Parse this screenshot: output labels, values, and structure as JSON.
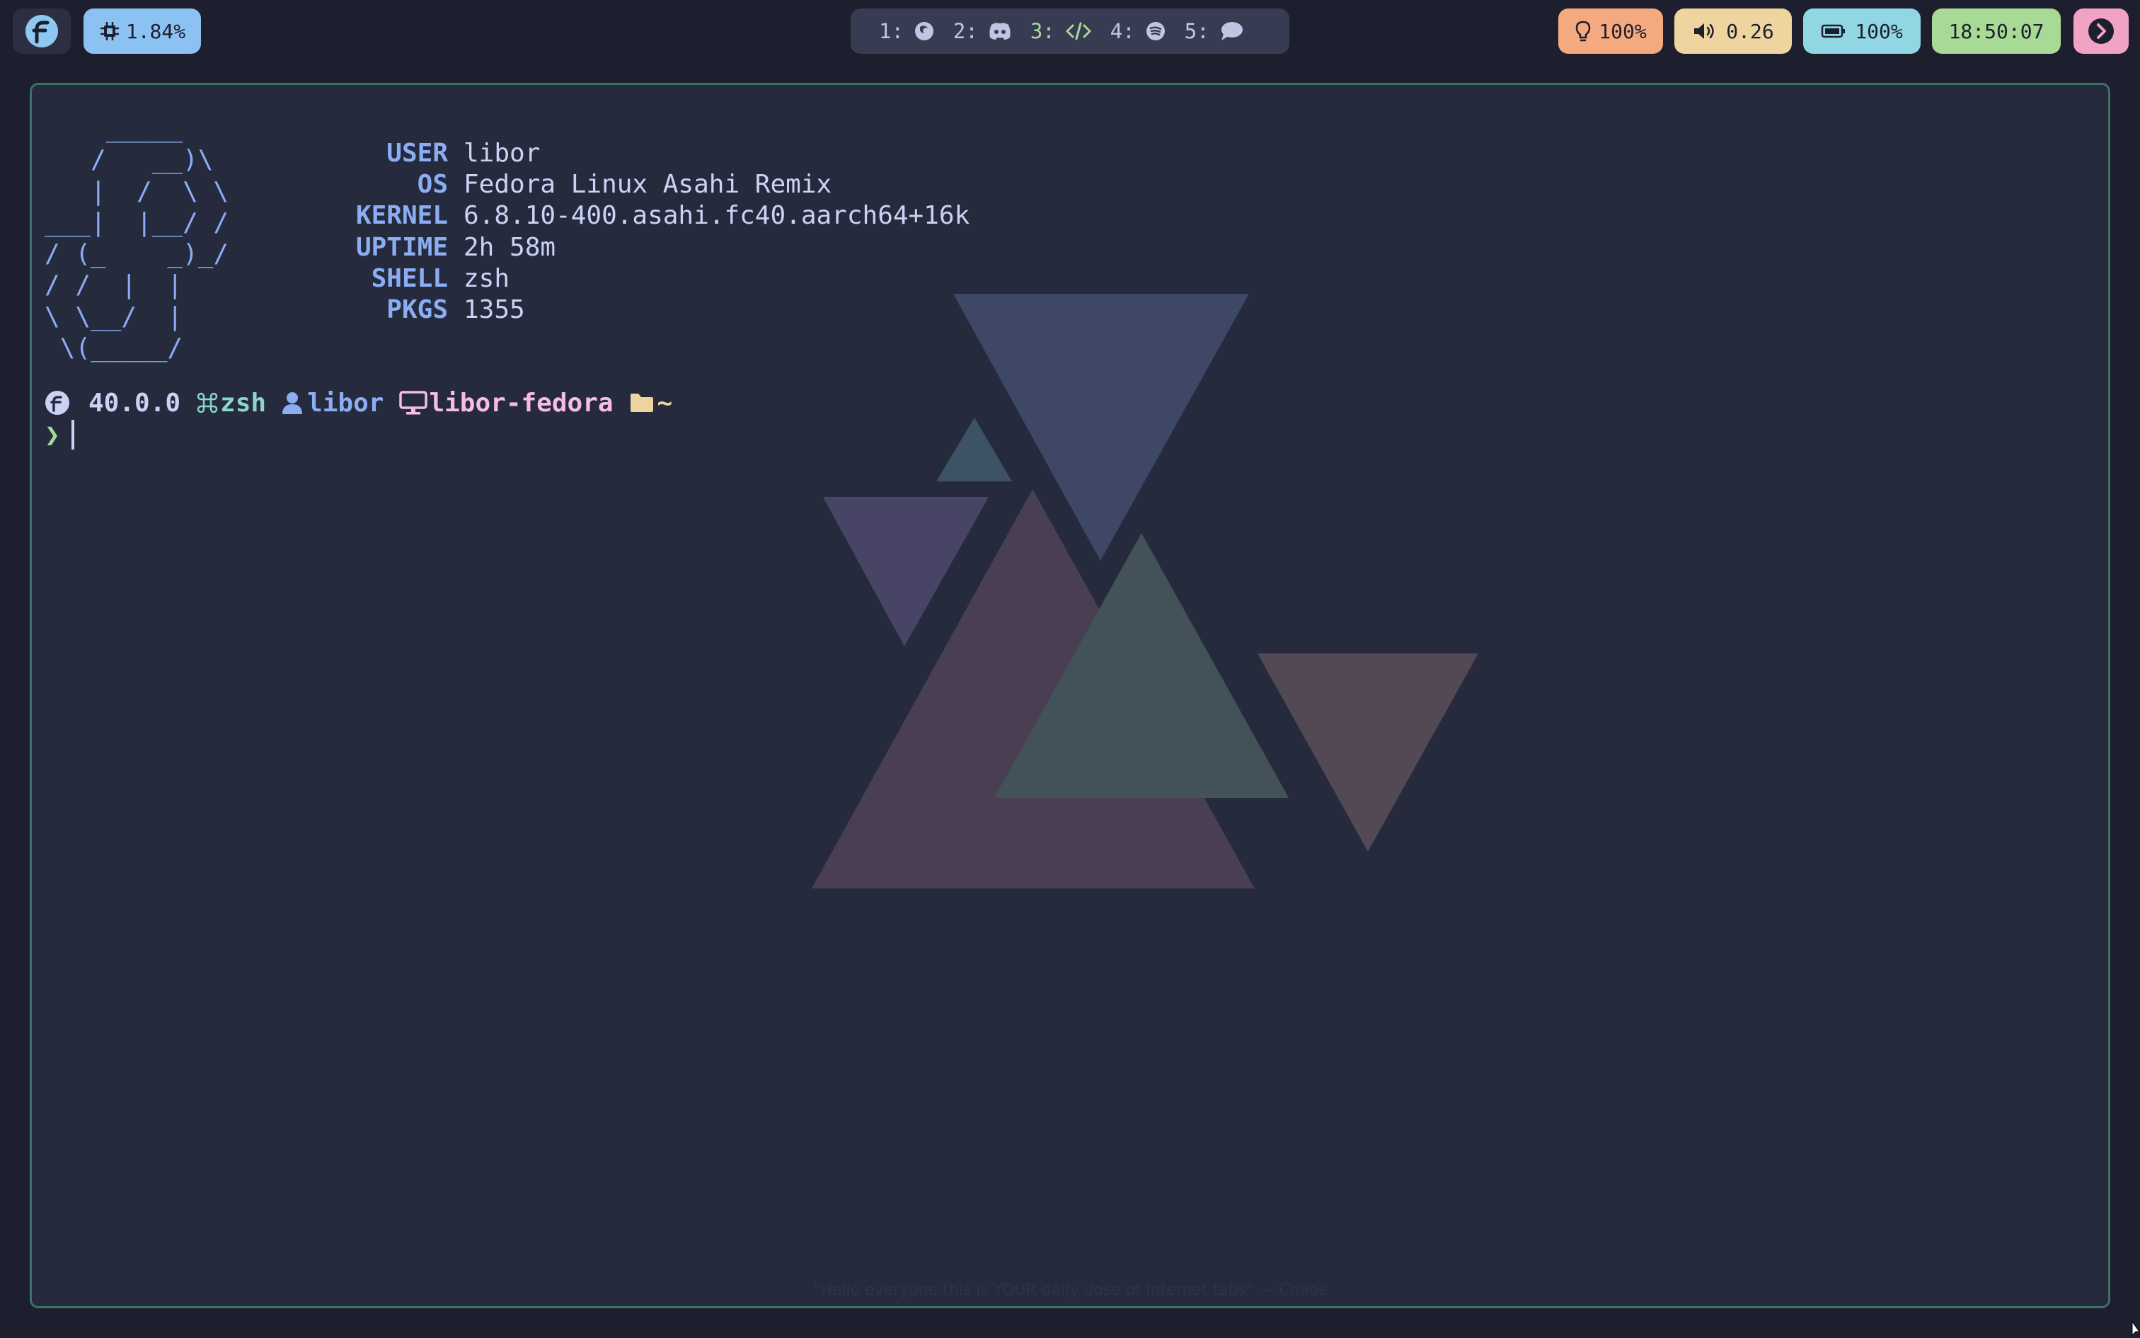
{
  "colors": {
    "background": "#1e1f2e",
    "terminal_bg": "#262a3d",
    "terminal_border": "#3f6f66",
    "blue": "#8aadf4",
    "green": "#a6da95",
    "teal": "#8bd5ca",
    "pink": "#f5bde6",
    "yellow": "#eed49f",
    "peach": "#f5a97f",
    "sky": "#91d7e3",
    "text": "#cad3f5"
  },
  "topbar": {
    "launcher": {
      "icon": "fedora-logo-icon"
    },
    "cpu": {
      "icon": "cpu-chip-icon",
      "label": "1.84%"
    },
    "workspaces": [
      {
        "num": "1:",
        "icon": "firefox-icon",
        "active": false
      },
      {
        "num": "2:",
        "icon": "discord-icon",
        "active": false
      },
      {
        "num": "3:",
        "icon": "code-icon",
        "active": true
      },
      {
        "num": "4:",
        "icon": "spotify-icon",
        "active": false
      },
      {
        "num": "5:",
        "icon": "chat-bubble-icon",
        "active": false
      }
    ],
    "brightness": {
      "icon": "lightbulb-icon",
      "label": "100%"
    },
    "volume": {
      "icon": "speaker-icon",
      "label": "0.26"
    },
    "battery": {
      "icon": "battery-icon",
      "label": "100%"
    },
    "clock": {
      "label": "18:50:07"
    },
    "power": {
      "icon": "chevron-right-icon"
    }
  },
  "terminal": {
    "ascii_logo": "    _____\n   /   __)\\\n   |  /  \\ \\\n___|  |__/ /\n/ (_    _)_/\n/ /  |  |\n\\ \\__/  |\n \\(_____/",
    "info": [
      {
        "key": "USER",
        "value": "libor"
      },
      {
        "key": "OS",
        "value": "Fedora Linux Asahi Remix"
      },
      {
        "key": "KERNEL",
        "value": "6.8.10-400.asahi.fc40.aarch64+16k"
      },
      {
        "key": "UPTIME",
        "value": "2h 58m"
      },
      {
        "key": "SHELL",
        "value": "zsh"
      },
      {
        "key": "PKGS",
        "value": "1355"
      }
    ],
    "prompt": {
      "os_icon": "fedora-logo-icon",
      "version": "40.0.0",
      "shell_icon": "command-key-icon",
      "shell": "zsh",
      "user_icon": "user-icon",
      "user": "libor",
      "host_icon": "monitor-icon",
      "host": "libor-fedora",
      "dir_icon": "folder-icon",
      "dir": "~",
      "prompt_char": "❯"
    },
    "wallpaper_quote": "\"Hello everyone this is YOUR daily dose of Internet tabs\" — Chaos"
  }
}
